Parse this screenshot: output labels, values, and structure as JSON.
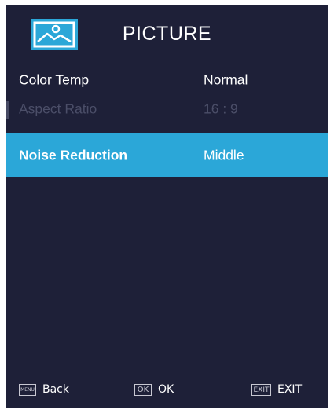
{
  "header": {
    "title": "PICTURE",
    "icon": "picture-icon"
  },
  "menu": [
    {
      "label": "Color Temp",
      "value": "Normal",
      "state": "normal"
    },
    {
      "label": "Aspect Ratio",
      "value": "16 : 9",
      "state": "disabled"
    },
    {
      "label": "Noise Reduction",
      "value": "Middle",
      "state": "selected"
    }
  ],
  "footer": {
    "back": {
      "key": "MENU",
      "label": "Back"
    },
    "ok": {
      "key": "OK",
      "label": "OK"
    },
    "exit": {
      "key": "EXIT",
      "label": "EXIT"
    }
  },
  "colors": {
    "background": "#1e2038",
    "highlight": "#2ba7d8",
    "disabled_text": "#4b4e68"
  }
}
